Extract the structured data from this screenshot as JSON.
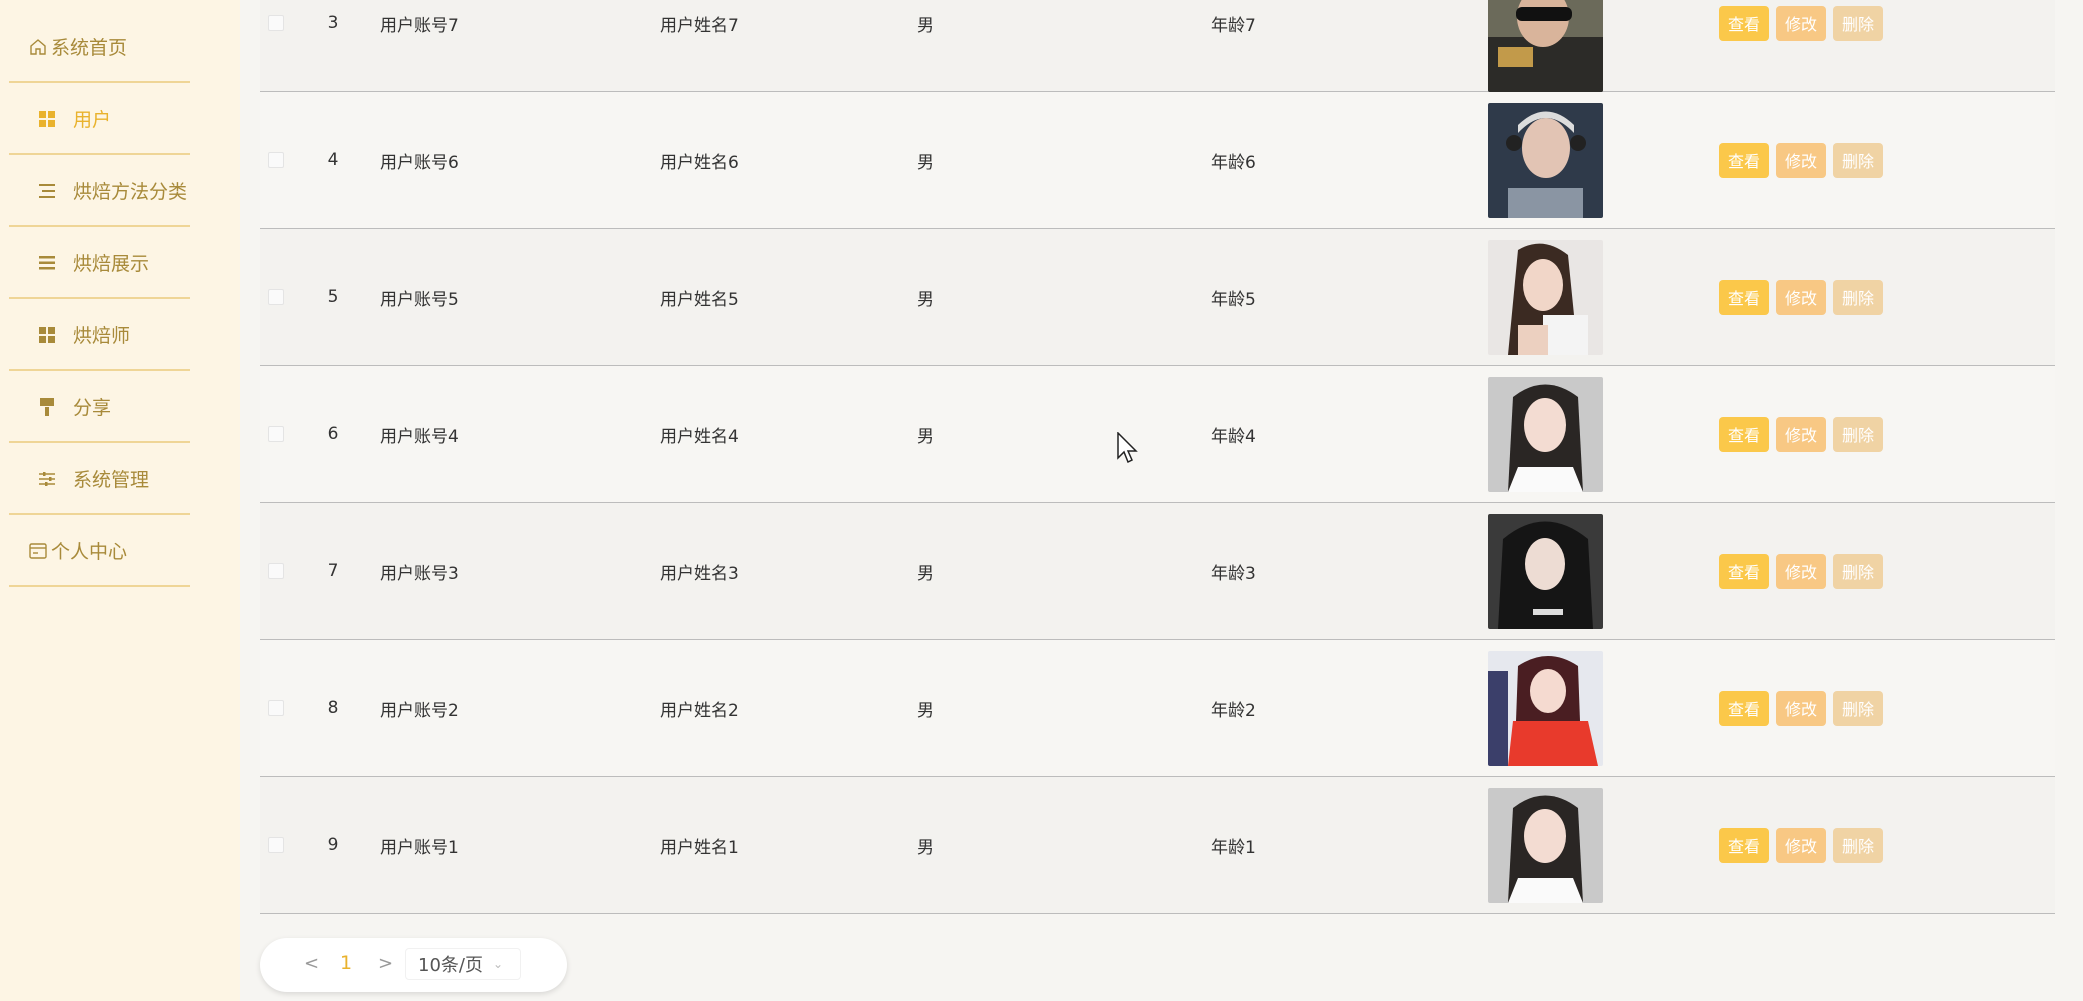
{
  "sidebar": {
    "items": [
      {
        "label": "系统首页",
        "icon": "home-icon"
      },
      {
        "label": "用户",
        "icon": "grid-icon"
      },
      {
        "label": "烘焙方法分类",
        "icon": "list-icon"
      },
      {
        "label": "烘焙展示",
        "icon": "menu-icon"
      },
      {
        "label": "烘焙师",
        "icon": "grid-icon"
      },
      {
        "label": "分享",
        "icon": "brush-icon"
      },
      {
        "label": "系统管理",
        "icon": "sliders-icon"
      },
      {
        "label": "个人中心",
        "icon": "card-icon"
      }
    ]
  },
  "table": {
    "rows": [
      {
        "index": "3",
        "account": "用户账号7",
        "name": "用户姓名7",
        "sex": "男",
        "age": "年龄7"
      },
      {
        "index": "4",
        "account": "用户账号6",
        "name": "用户姓名6",
        "sex": "男",
        "age": "年龄6"
      },
      {
        "index": "5",
        "account": "用户账号5",
        "name": "用户姓名5",
        "sex": "男",
        "age": "年龄5"
      },
      {
        "index": "6",
        "account": "用户账号4",
        "name": "用户姓名4",
        "sex": "男",
        "age": "年龄4"
      },
      {
        "index": "7",
        "account": "用户账号3",
        "name": "用户姓名3",
        "sex": "男",
        "age": "年龄3"
      },
      {
        "index": "8",
        "account": "用户账号2",
        "name": "用户姓名2",
        "sex": "男",
        "age": "年龄2"
      },
      {
        "index": "9",
        "account": "用户账号1",
        "name": "用户姓名1",
        "sex": "男",
        "age": "年龄1"
      }
    ],
    "actions": {
      "view": "查看",
      "edit": "修改",
      "delete": "删除"
    }
  },
  "pagination": {
    "prev": "<",
    "current_page": "1",
    "next": ">",
    "page_size": "10条/页"
  },
  "colors": {
    "sidebar_bg": "#fdf5e4",
    "accent": "#e9b22d",
    "nav_text": "#a88a3a",
    "view_button": "#fbc84a",
    "edit_button": "#f8c884",
    "delete_button": "#f0d3a4"
  }
}
